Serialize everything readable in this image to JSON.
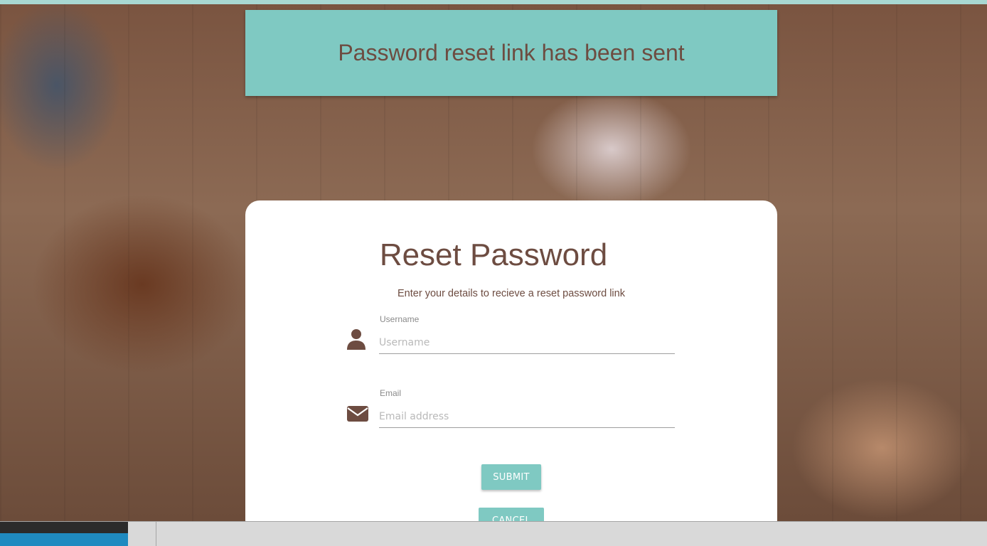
{
  "toast": {
    "message": "Password reset link has been sent"
  },
  "form": {
    "title": "Reset Password",
    "subtitle": "Enter your details to recieve a reset password link",
    "username": {
      "label": "Username",
      "placeholder": "Username",
      "value": "",
      "icon": "user-icon"
    },
    "email": {
      "label": "Email",
      "placeholder": "Email address",
      "value": "",
      "icon": "envelope-icon"
    },
    "submit_label": "SUBMIT",
    "cancel_label": "CANCEL"
  },
  "colors": {
    "accent": "#7fc9c2",
    "text_brown": "#6d4c41",
    "card_bg": "#ffffff"
  }
}
